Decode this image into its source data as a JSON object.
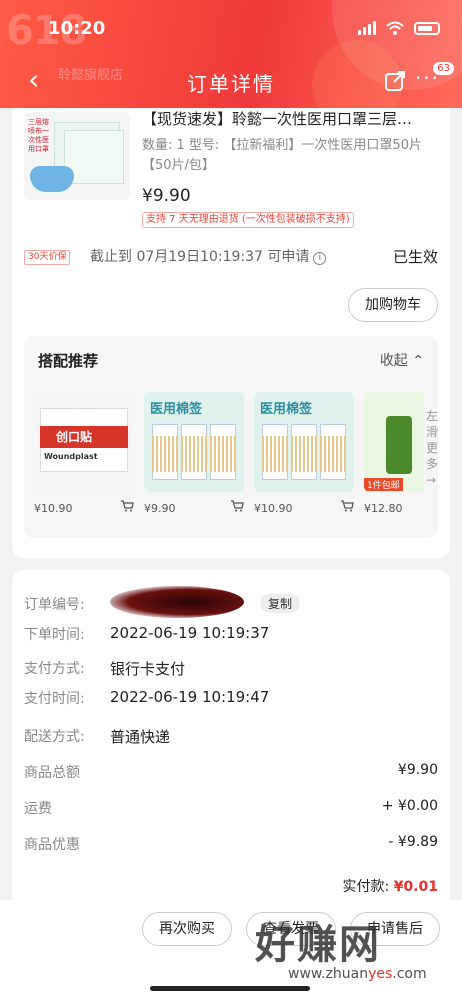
{
  "status_bar": {
    "time": "10:20"
  },
  "header": {
    "bg_text": "618",
    "shop_name": "聆懿旗舰店",
    "title": "订单详情",
    "badge": "63",
    "back_icon": "chevron-left-icon",
    "share_icon": "share-icon",
    "more_icon": "more-icon"
  },
  "product": {
    "title": "【现货速发】聆懿一次性医用口罩三层…",
    "spec": "数量: 1  型号: 【拉新福利】一次性医用口罩50片【50片/包】",
    "price": "¥9.90",
    "return_tag": "支持 7 天无理由退货 (一次性包装破损不支持)",
    "guarantee_tag": "30天价保",
    "guarantee_text": "截止到 07月19日10:19:37 可申请",
    "guarantee_info_icon": "i",
    "guarantee_status": "已生效",
    "add_cart_label": "加购物车",
    "thumb_text": "三层熔喷布一次性医用口罩"
  },
  "recommend": {
    "title": "搭配推荐",
    "fold_label": "收起",
    "slide_hint": "左滑更多",
    "items": [
      {
        "price": "¥10.90",
        "img_title": "创口贴",
        "img_sub": "Woundplast"
      },
      {
        "price": "¥9.90",
        "img_title": "医用棉签"
      },
      {
        "price": "¥10.90",
        "img_title": "医用棉签"
      },
      {
        "price": "¥12.80",
        "img_tag": "1件包邮"
      }
    ]
  },
  "order": {
    "number_label": "订单编号:",
    "copy_label": "复制",
    "rows": [
      {
        "label": "下单时间:",
        "value": "2022-06-19 10:19:37"
      },
      {
        "label": "支付方式:",
        "value": "银行卡支付"
      },
      {
        "label": "支付时间:",
        "value": "2022-06-19 10:19:47"
      },
      {
        "label": "配送方式:",
        "value": "普通快递"
      }
    ],
    "amounts": [
      {
        "label": "商品总额",
        "value": "¥9.90"
      },
      {
        "label": "运费",
        "value": "+ ¥0.00"
      },
      {
        "label": "商品优惠",
        "value": "- ¥9.89"
      }
    ],
    "paid_label": "实付款:",
    "paid_value": "¥0.01"
  },
  "bottom": {
    "buttons": [
      "再次购买",
      "查看发票",
      "申请售后"
    ]
  },
  "watermark": {
    "main": "好赚网",
    "site_pre": "www.zhuan",
    "site_mid": "yes",
    "site_post": ".com"
  }
}
